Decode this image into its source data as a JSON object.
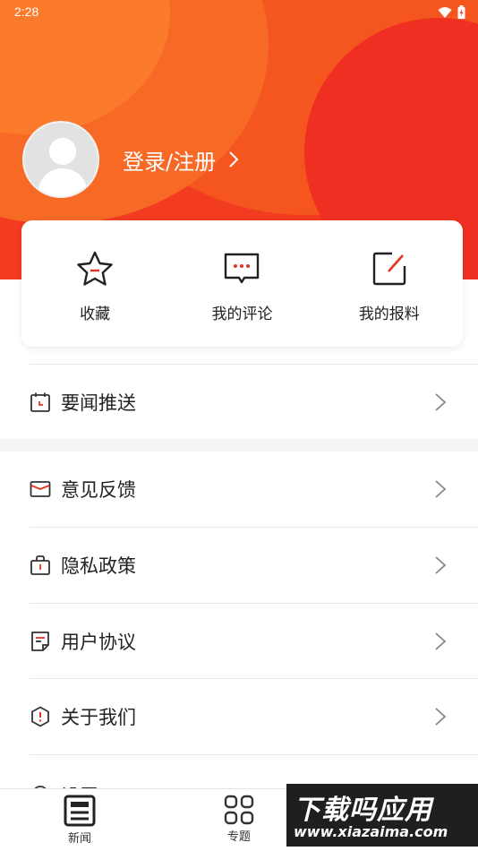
{
  "status_bar": {
    "time": "2:28"
  },
  "profile": {
    "login_label": "登录/注册"
  },
  "quick_actions": [
    {
      "label": "收藏",
      "icon": "star-icon"
    },
    {
      "label": "我的评论",
      "icon": "comment-icon"
    },
    {
      "label": "我的报料",
      "icon": "edit-note-icon"
    }
  ],
  "menu": {
    "news_push": "要闻推送",
    "feedback": "意见反馈",
    "privacy": "隐私政策",
    "agreement": "用户协议",
    "about": "关于我们",
    "settings": "设置"
  },
  "bottom_nav": {
    "news": "新闻",
    "topics": "专题"
  },
  "watermark": {
    "line1": "下载吗应用",
    "line2": "www.xiazaima.com"
  },
  "colors": {
    "accent": "#f23b20",
    "icon_red": "#e6331f"
  }
}
